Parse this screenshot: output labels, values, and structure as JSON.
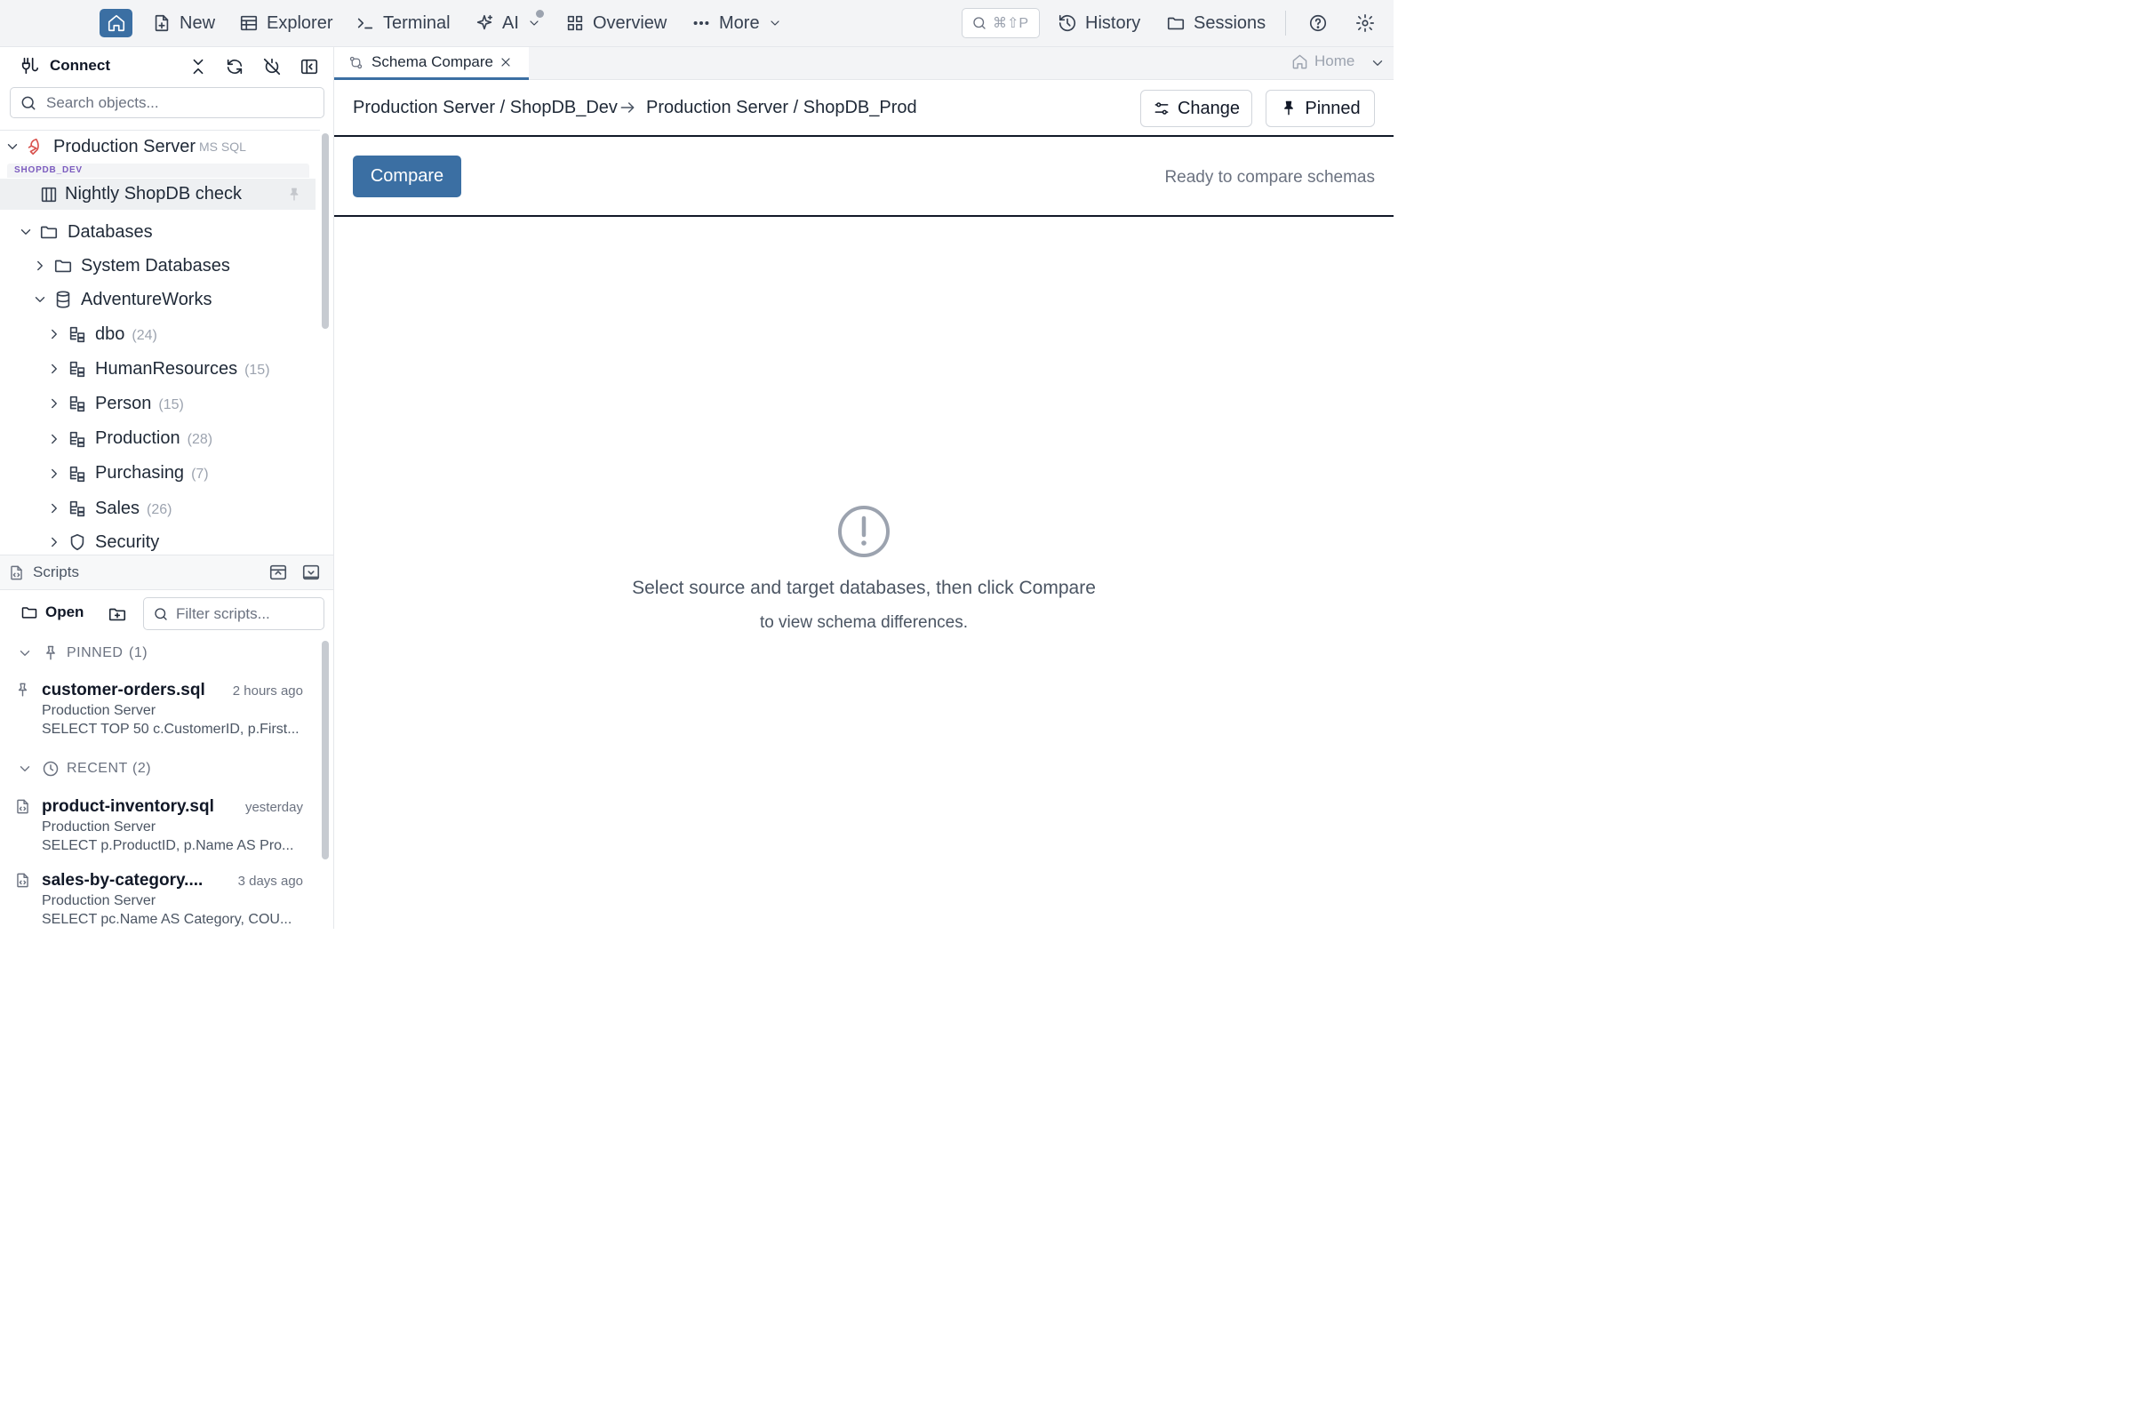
{
  "topbar": {
    "new": "New",
    "explorer": "Explorer",
    "terminal": "Terminal",
    "ai": "AI",
    "overview": "Overview",
    "more": "More",
    "search_shortcut": "⌘⇧P",
    "history": "History",
    "sessions": "Sessions"
  },
  "left": {
    "connect": "Connect",
    "search_placeholder": "Search objects...",
    "server": {
      "name": "Production Server",
      "type": "MS SQL"
    },
    "pinned_badge": "SHOPDB_DEV",
    "pinned_item": "Nightly ShopDB check",
    "databases": "Databases",
    "system_databases": "System Databases",
    "adventureworks": "AdventureWorks",
    "schemas": [
      {
        "name": "dbo",
        "count": "(24)"
      },
      {
        "name": "HumanResources",
        "count": "(15)"
      },
      {
        "name": "Person",
        "count": "(15)"
      },
      {
        "name": "Production",
        "count": "(28)"
      },
      {
        "name": "Purchasing",
        "count": "(7)"
      },
      {
        "name": "Sales",
        "count": "(26)"
      }
    ],
    "security": "Security"
  },
  "scripts": {
    "title": "Scripts",
    "open": "Open",
    "filter_placeholder": "Filter scripts...",
    "pinned_label": "PINNED",
    "pinned_count": "(1)",
    "recent_label": "RECENT",
    "recent_count": "(2)",
    "pinned_items": [
      {
        "name": "customer-orders.sql",
        "time": "2 hours ago",
        "server": "Production Server",
        "sql": "SELECT TOP 50 c.CustomerID, p.First..."
      }
    ],
    "recent_items": [
      {
        "name": "product-inventory.sql",
        "time": "yesterday",
        "server": "Production Server",
        "sql": "SELECT p.ProductID, p.Name AS Pro..."
      },
      {
        "name": "sales-by-category....",
        "time": "3 days ago",
        "server": "Production Server",
        "sql": "SELECT pc.Name AS Category, COU..."
      }
    ]
  },
  "main": {
    "tab_label": "Schema Compare",
    "home": "Home",
    "source": "Production Server / ShopDB_Dev",
    "target": "Production Server / ShopDB_Prod",
    "change": "Change",
    "pinned": "Pinned",
    "compare": "Compare",
    "status": "Ready to compare schemas",
    "empty_line1": "Select source and target databases, then click Compare",
    "empty_line2": "to view schema differences."
  },
  "colors": {
    "accent": "#3b6fa3",
    "server_icon": "#d9534f",
    "badge": "#7c5cbf"
  }
}
